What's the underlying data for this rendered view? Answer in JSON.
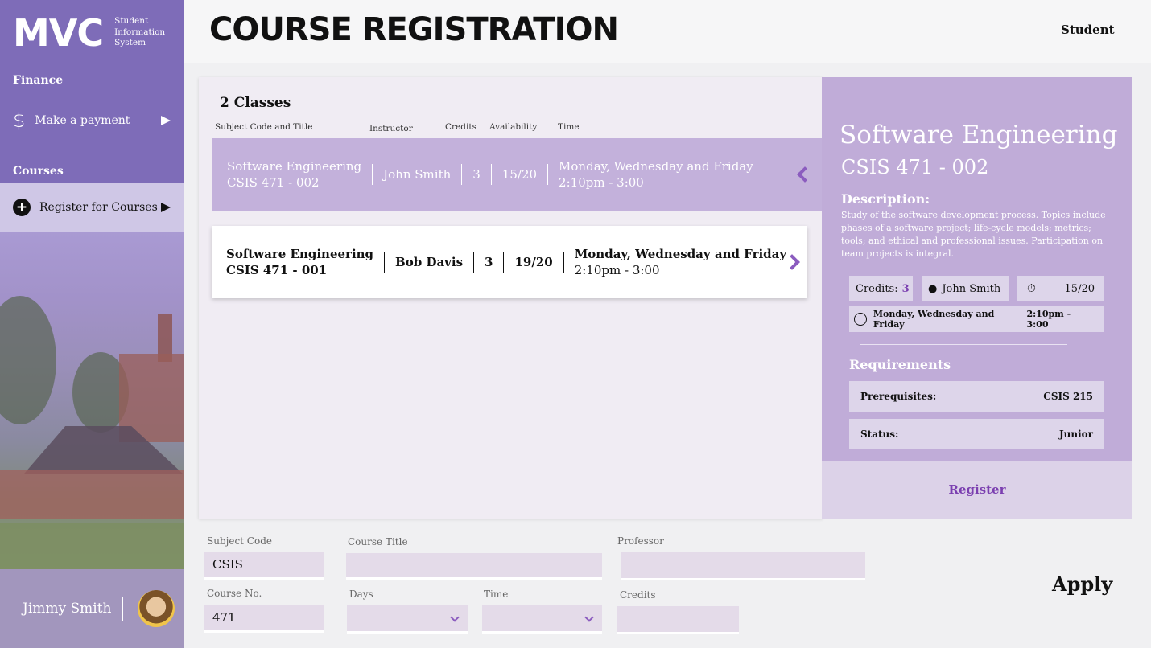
{
  "sidebar": {
    "logo": "MVC",
    "logo_sub": [
      "Student",
      "Information",
      "System"
    ],
    "finance_heading": "Finance",
    "payment_label": "Make a payment",
    "courses_heading": "Courses",
    "register_label": "Register for Courses",
    "user_name": "Jimmy Smith"
  },
  "header": {
    "title": "COURSE REGISTRATION",
    "role": "Student"
  },
  "list": {
    "count": "2 Classes",
    "columns": [
      "Subject Code and Title",
      "Instructor",
      "Credits",
      "Availability",
      "Time"
    ],
    "rows": [
      {
        "title": "Software Engineering",
        "code": "CSIS 471 - 002",
        "instructor": "John Smith",
        "credits": "3",
        "availability": "15/20",
        "days": "Monday, Wednesday and Friday",
        "time": "2:10pm - 3:00"
      },
      {
        "title": "Software Engineering",
        "code": "CSIS 471 - 001",
        "instructor": "Bob Davis",
        "credits": "3",
        "availability": "19/20",
        "days": "Monday, Wednesday and Friday",
        "time": "2:10pm - 3:00"
      }
    ]
  },
  "detail": {
    "title": "Software Engineering",
    "code": "CSIS 471 - 002",
    "description_heading": "Description:",
    "description": "Study of the software development process. Topics include phases of a software project; life-cycle models; metrics; tools; and ethical and professional issues. Participation on team projects is integral.",
    "credits_label": "Credits:",
    "credits_value": "3",
    "instructor": "John Smith",
    "availability": "15/20",
    "days": "Monday, Wednesday and Friday",
    "time": "2:10pm - 3:00",
    "requirements_heading": "Requirements",
    "prereq_label": "Prerequisites:",
    "prereq_value": "CSIS 215",
    "status_label": "Status:",
    "status_value": "Junior",
    "register_label": "Register"
  },
  "filters": {
    "subject_code_label": "Subject Code",
    "subject_code_value": "CSIS",
    "course_title_label": "Course Title",
    "course_title_value": "",
    "professor_label": "Professor",
    "professor_value": "",
    "course_no_label": "Course No.",
    "course_no_value": "471",
    "days_label": "Days",
    "time_label": "Time",
    "credits_label": "Credits",
    "credits_value": "",
    "apply_label": "Apply"
  }
}
